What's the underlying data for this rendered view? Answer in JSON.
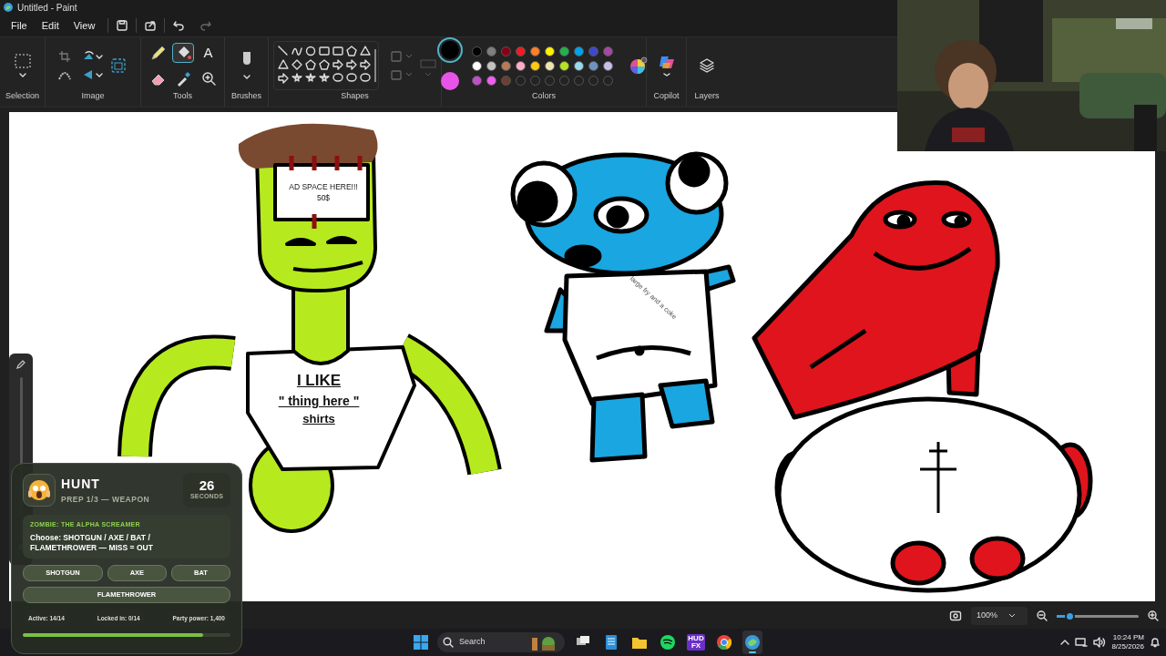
{
  "window": {
    "title": "Untitled - Paint"
  },
  "menu": [
    "File",
    "Edit",
    "View"
  ],
  "ribbon_groups": [
    {
      "label": "Selection"
    },
    {
      "label": "Image"
    },
    {
      "label": "Tools"
    },
    {
      "label": "Brushes"
    },
    {
      "label": "Shapes"
    },
    {
      "label": "Colors"
    },
    {
      "label": "Copilot"
    },
    {
      "label": "Layers"
    }
  ],
  "tools": [
    {
      "kind": "pencil",
      "selected": false
    },
    {
      "kind": "fill",
      "selected": true
    },
    {
      "kind": "text",
      "glyph": "A",
      "selected": false
    },
    {
      "kind": "eraser",
      "selected": false
    },
    {
      "kind": "picker",
      "selected": false
    },
    {
      "kind": "magnifier",
      "selected": false
    }
  ],
  "colors": {
    "primary": {
      "color": "#000000",
      "selected": true
    },
    "secondary": {
      "color": "#e854e8",
      "selected": false
    },
    "swatches": [
      {
        "kind": "color",
        "color": "#000000"
      },
      {
        "kind": "color",
        "color": "#7f7f7f"
      },
      {
        "kind": "color",
        "color": "#880015"
      },
      {
        "kind": "color",
        "color": "#ed1c24"
      },
      {
        "kind": "color",
        "color": "#ff7f27"
      },
      {
        "kind": "color",
        "color": "#fff200"
      },
      {
        "kind": "color",
        "color": "#22b14c"
      },
      {
        "kind": "color",
        "color": "#00a2e8"
      },
      {
        "kind": "color",
        "color": "#3f48cc"
      },
      {
        "kind": "color",
        "color": "#a349a4"
      },
      {
        "kind": "color",
        "color": "#ffffff"
      },
      {
        "kind": "color",
        "color": "#c3c3c3"
      },
      {
        "kind": "color",
        "color": "#b97a57"
      },
      {
        "kind": "color",
        "color": "#ffaec9"
      },
      {
        "kind": "color",
        "color": "#ffc90e"
      },
      {
        "kind": "color",
        "color": "#efe4b0"
      },
      {
        "kind": "color",
        "color": "#b5e61d"
      },
      {
        "kind": "color",
        "color": "#99d9ea"
      },
      {
        "kind": "color",
        "color": "#7092be"
      },
      {
        "kind": "color",
        "color": "#c8bfe7"
      },
      {
        "kind": "color",
        "color": "#c050c8"
      },
      {
        "kind": "color",
        "color": "#f060f0"
      },
      {
        "kind": "color",
        "color": "#6b4030"
      },
      {
        "kind": "empty"
      },
      {
        "kind": "empty"
      },
      {
        "kind": "empty"
      },
      {
        "kind": "empty"
      },
      {
        "kind": "empty"
      },
      {
        "kind": "empty"
      },
      {
        "kind": "empty"
      }
    ]
  },
  "brush_size": {
    "level": 0.02
  },
  "characters": [
    {
      "kind": "zombie",
      "sign": [
        "AD SPACE HERE!!!",
        "50$"
      ],
      "shirt": [
        "I LIKE",
        "\" thing here \"",
        "shirts"
      ]
    },
    {
      "kind": "dog",
      "shirt": [
        "large fry and a coke"
      ]
    },
    {
      "kind": "dino"
    }
  ],
  "hud": {
    "title": "HUNT",
    "subtitle": "PREP 1/3 — WEAPON",
    "countdown": "26",
    "countdown_unit": "SECONDS",
    "prompt_label": "ZOMBIE: THE ALPHA SCREAMER",
    "prompt": "Choose: SHOTGUN / AXE / BAT / FLAMETHROWER — MISS = OUT",
    "choices": [
      "SHOTGUN",
      "AXE",
      "BAT",
      "FLAMETHROWER"
    ],
    "stats": [
      "Active: 14/14",
      "Locked in: 0/14",
      "Party power: 1,400"
    ],
    "progress": {
      "level": 0.87
    }
  },
  "status_bar": {
    "zoom": "100%",
    "zoom_slider": {
      "level": 0.15
    }
  },
  "taskbar": {
    "search_placeholder": "Search",
    "apps": [
      {
        "kind": "taskview",
        "selected": false
      },
      {
        "kind": "notepad",
        "selected": false
      },
      {
        "kind": "explorer",
        "selected": false
      },
      {
        "kind": "spotify",
        "selected": false
      },
      {
        "kind": "hudfx",
        "label": "HUD FX",
        "selected": false
      },
      {
        "kind": "chrome",
        "selected": false
      },
      {
        "kind": "paint",
        "selected": true
      }
    ],
    "time": "10:24 PM",
    "date": "8/25/2026"
  }
}
